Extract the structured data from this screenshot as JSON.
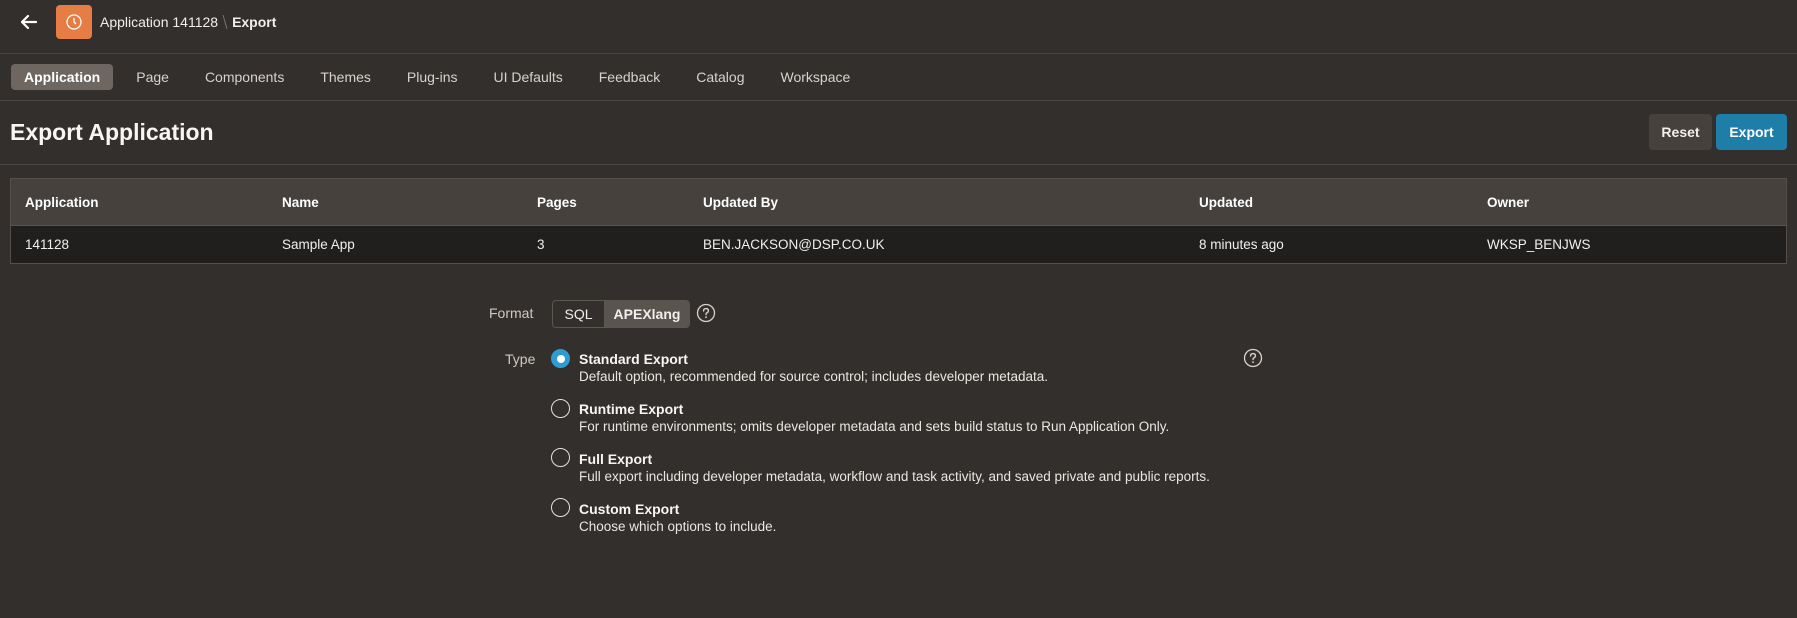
{
  "header": {
    "breadcrumb": [
      "Application 141128",
      "Export"
    ],
    "back_icon": "arrow-left-icon",
    "logo_icon": "clock-icon",
    "logo_color": "#e57d45"
  },
  "tabs": [
    {
      "label": "Application",
      "active": true
    },
    {
      "label": "Page"
    },
    {
      "label": "Components"
    },
    {
      "label": "Themes"
    },
    {
      "label": "Plug-ins"
    },
    {
      "label": "UI Defaults"
    },
    {
      "label": "Feedback"
    },
    {
      "label": "Catalog"
    },
    {
      "label": "Workspace"
    }
  ],
  "page": {
    "title": "Export Application",
    "reset_label": "Reset",
    "export_label": "Export",
    "accent": "#1f7ea8"
  },
  "table": {
    "columns": [
      "Application",
      "Name",
      "Pages",
      "Updated By",
      "Updated",
      "Owner"
    ],
    "rows": [
      [
        "141128",
        "Sample App",
        "3",
        "BEN.JACKSON@DSP.CO.UK",
        "8 minutes ago",
        "WKSP_BENJWS"
      ]
    ]
  },
  "form": {
    "format_label": "Format",
    "format_options": [
      "SQL",
      "APEXlang"
    ],
    "format_selected": "APEXlang",
    "type_label": "Type",
    "type_options": [
      {
        "title": "Standard Export",
        "desc": "Default option, recommended for source control; includes developer metadata.",
        "checked": true
      },
      {
        "title": "Runtime Export",
        "desc": "For runtime environments; omits developer metadata and sets build status to Run Application Only."
      },
      {
        "title": "Full Export",
        "desc": "Full export including developer metadata, workflow and task activity, and saved private and public reports."
      },
      {
        "title": "Custom Export",
        "desc": "Choose which options to include."
      }
    ]
  }
}
